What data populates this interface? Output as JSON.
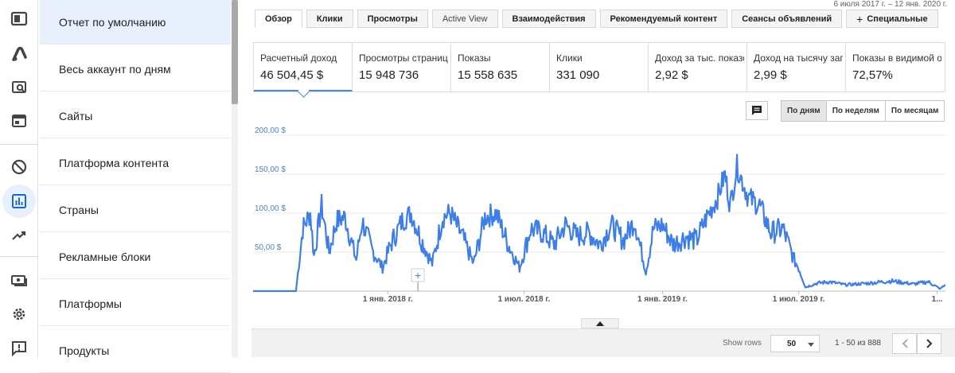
{
  "header": {
    "date_range": "6 июля 2017 г. – 12 янв. 2020 г."
  },
  "rail": {
    "icons": [
      "dashboard-icon",
      "adsense-logo-icon",
      "content-search-icon",
      "browser-window-icon",
      "block-icon",
      "reports-icon",
      "trending-icon",
      "payments-icon",
      "settings-icon",
      "feedback-icon"
    ],
    "active_icon": "reports-icon"
  },
  "reports": {
    "items": [
      "Отчет по умолчанию",
      "Весь аккаунт по дням",
      "Сайты",
      "Платформа контента",
      "Страны",
      "Рекламные блоки",
      "Платформы",
      "Продукты"
    ],
    "active_index": 0
  },
  "tabs": [
    {
      "label": "Обзор"
    },
    {
      "label": "Клики"
    },
    {
      "label": "Просмотры"
    },
    {
      "label": "Active View"
    },
    {
      "label": "Взаимодействия"
    },
    {
      "label": "Рекомендуемый контент"
    },
    {
      "label": "Сеансы объявлений"
    },
    {
      "label": "Специальные",
      "icon": "+"
    }
  ],
  "metrics": [
    {
      "label": "Расчетный доход",
      "value": "46 504,45 $"
    },
    {
      "label": "Просмотры страниц",
      "value": "15 948 736"
    },
    {
      "label": "Показы",
      "value": "15 558 635"
    },
    {
      "label": "Клики",
      "value": "331 090"
    },
    {
      "label": "Доход за тыс. показов",
      "value": "2,92 $"
    },
    {
      "label": "Доход на тысячу запросов",
      "value": "2,99 $"
    },
    {
      "label": "Показы в видимой области",
      "value": "72,57%"
    }
  ],
  "period": {
    "day": "По дням",
    "week": "По неделям",
    "month": "По месяцам",
    "active": "day"
  },
  "chart_data": {
    "type": "line",
    "color": "#3d7ee9",
    "ylim": [
      0,
      200
    ],
    "y_ticks": [
      "200,00 $",
      "150,00 $",
      "100,00 $",
      "50,00 $"
    ],
    "x_ticks": [
      "1 янв. 2018 г.",
      "1 июл. 2018 г.",
      "1 янв. 2019 г.",
      "1 июл. 2019 г.",
      "1..."
    ],
    "series": [
      {
        "x": [
          "2017-07-06",
          "2017-07-25",
          "2017-08-15",
          "2017-09-01",
          "2017-09-10",
          "2017-09-20",
          "2017-09-25",
          "2017-10-05",
          "2017-10-15",
          "2017-10-25",
          "2017-11-05",
          "2017-11-20",
          "2017-11-28",
          "2017-12-10",
          "2017-12-25",
          "2018-01-05",
          "2018-01-20",
          "2018-02-01",
          "2018-02-15",
          "2018-03-01",
          "2018-03-15",
          "2018-03-25",
          "2018-04-10",
          "2018-04-25",
          "2018-05-10",
          "2018-05-25",
          "2018-06-10",
          "2018-06-25",
          "2018-07-10",
          "2018-07-25",
          "2018-08-10",
          "2018-08-25",
          "2018-09-10",
          "2018-09-25",
          "2018-10-10",
          "2018-10-25",
          "2018-11-10",
          "2018-11-25",
          "2018-12-10",
          "2018-12-20",
          "2019-01-01",
          "2019-01-15",
          "2019-02-01",
          "2019-02-15",
          "2019-03-01",
          "2019-03-15",
          "2019-03-25",
          "2019-04-01",
          "2019-04-10",
          "2019-04-25",
          "2019-05-10",
          "2019-05-25",
          "2019-06-10",
          "2019-06-25",
          "2019-07-01",
          "2019-07-10",
          "2019-07-25",
          "2019-08-10",
          "2019-09-01",
          "2019-10-01",
          "2019-11-01",
          "2019-12-01",
          "2019-12-20",
          "2020-01-05",
          "2020-01-12"
        ],
        "y": [
          0,
          0,
          0,
          0,
          80,
          100,
          45,
          110,
          50,
          90,
          95,
          40,
          90,
          55,
          30,
          60,
          90,
          100,
          65,
          35,
          95,
          100,
          70,
          35,
          95,
          100,
          60,
          30,
          80,
          75,
          60,
          85,
          70,
          75,
          60,
          85,
          65,
          90,
          25,
          80,
          85,
          60,
          70,
          65,
          95,
          120,
          150,
          110,
          160,
          120,
          110,
          75,
          80,
          40,
          30,
          5,
          10,
          12,
          8,
          10,
          13,
          9,
          12,
          3,
          8
        ]
      }
    ]
  },
  "table": {
    "show_rows_label": "Show rows",
    "rows_value": "50",
    "page_range": "1 - 50 из 888"
  }
}
